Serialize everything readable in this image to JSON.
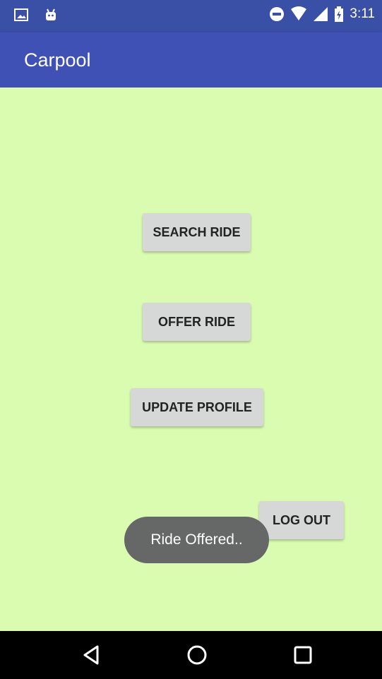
{
  "status_bar": {
    "time": "3:11",
    "left_icons": [
      "image-icon",
      "android-icon"
    ],
    "right_icons": [
      "do-not-disturb-icon",
      "wifi-icon",
      "signal-icon",
      "battery-icon"
    ]
  },
  "app_bar": {
    "title": "Carpool"
  },
  "buttons": {
    "search_ride": "SEARCH RIDE",
    "offer_ride": "OFFER RIDE",
    "update_profile": "UPDATE PROFILE",
    "log_out": "LOG OUT"
  },
  "toast": {
    "message": "Ride Offered.."
  },
  "nav_bar": {
    "icons": [
      "back-icon",
      "home-icon",
      "recents-icon"
    ]
  },
  "colors": {
    "primary": "#3f51b5",
    "status_bar": "#3a4fa6",
    "background": "#d9fcb0",
    "button": "#d6d7d7",
    "toast": "#656866"
  }
}
